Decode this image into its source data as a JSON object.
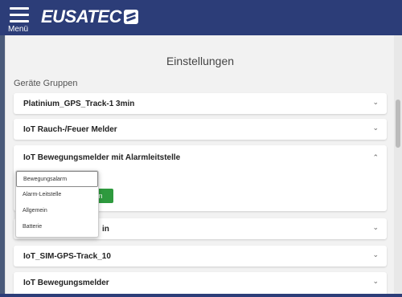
{
  "header": {
    "menu_label": "Menü",
    "logo_text": "EUSATEC"
  },
  "page": {
    "title": "Einstellungen",
    "section_title": "Geräte Gruppen"
  },
  "groups": [
    {
      "label": "Platinium_GPS_Track-1 3min",
      "expanded": false
    },
    {
      "label": "IoT Rauch-/Feuer Melder",
      "expanded": false
    },
    {
      "label": "IoT Bewegungsmelder mit Alarmleitstelle",
      "expanded": true
    },
    {
      "label": "in",
      "expanded": false
    },
    {
      "label": "IoT_SIM-GPS-Track_10",
      "expanded": false
    },
    {
      "label": "IoT Bewegungsmelder",
      "expanded": false
    }
  ],
  "expanded_card": {
    "faded_label": "...",
    "button_label": "em"
  },
  "dropdown": {
    "options": [
      "Bewegungsalarm",
      "Alarm-Leitstelle",
      "Allgemein",
      "Batterie"
    ],
    "selected_index": 0
  },
  "icons": {
    "chevron_down": "⌄",
    "chevron_up": "⌃"
  },
  "colors": {
    "header": "#2c3d78",
    "accent_green": "#2e9a3e"
  }
}
